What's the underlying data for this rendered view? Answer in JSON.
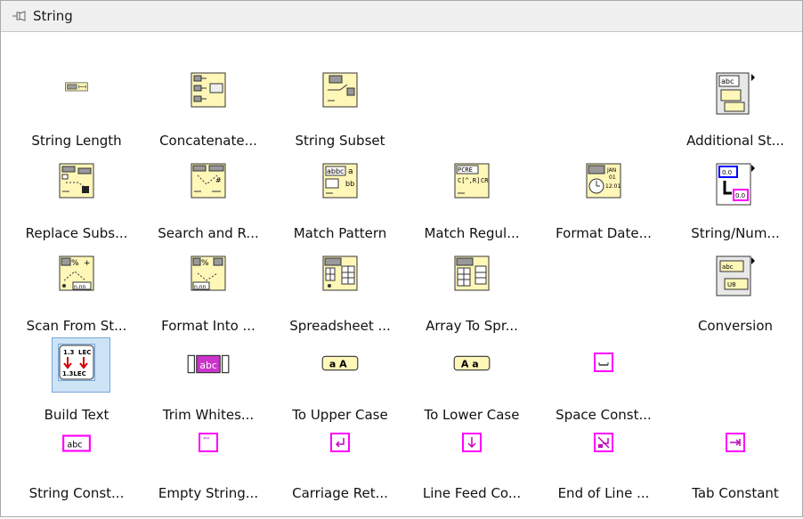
{
  "palette": {
    "title": "String",
    "rows": [
      [
        "String Length",
        "Concatenate...",
        "String Subset",
        "",
        "",
        "Additional St..."
      ],
      [
        "Replace Subs...",
        "Search and R...",
        "Match Pattern",
        "Match Regul...",
        "Format Date...",
        "String/Num..."
      ],
      [
        "Scan From St...",
        "Format Into ...",
        "Spreadsheet ...",
        "Array To Spr...",
        "",
        "Conversion"
      ],
      [
        "Build Text",
        "Trim Whites...",
        "To Upper Case",
        "To Lower Case",
        "Space Const...",
        ""
      ],
      [
        "String Const...",
        "Empty String...",
        "Carriage Ret...",
        "Line Feed Co...",
        "End of Line ...",
        "Tab Constant"
      ]
    ],
    "icon_texts": {
      "additional_abc": "abc",
      "match_pattern_abc": "abbc",
      "regex_pcre": "PCRE",
      "regex_cr": "CR",
      "date_jan": "JAN",
      "date_01": "01",
      "date_time": "12:01",
      "num_box": "0.0",
      "nnn": "n.nn",
      "pct": "%",
      "build_13": "1.3",
      "build_lec": "LEC",
      "trim_abc": "abc",
      "upper": "a A",
      "lower": "A a",
      "string_const": "abc",
      "empty_string": "\"\"",
      "conversion_abc": "abc",
      "conversion_u8": "U8"
    }
  }
}
